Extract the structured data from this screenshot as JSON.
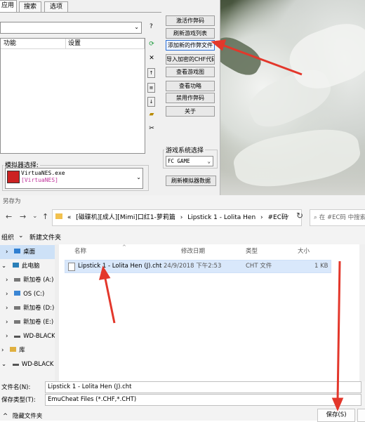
{
  "tool": {
    "tabs": [
      "应用",
      "搜索",
      "选项"
    ],
    "question_mark": "?",
    "columns": [
      "功能",
      "设置"
    ],
    "buttons": [
      "激活作弊码",
      "刷新游戏列表",
      "添加新的作弊文件",
      "导入加密的CHF代码",
      "查看游戏图",
      "查看功略",
      "禁用作弊码",
      "关于"
    ],
    "emulator_group_label": "模拟器选择:",
    "emulator_name": "VirtuaNES.exe",
    "emulator_tag": "[VirtuaNES]",
    "game_system_label": "游戏系统选择",
    "game_system_value": "FC GAME",
    "refresh_emu_button": "刷新模拟器数据"
  },
  "dialog": {
    "title": "另存为",
    "breadcrumb": [
      "«",
      "[磁碟机][成人][Mimi]口红1-萝莉篇",
      "Lipstick 1 - Lolita Hen",
      "#EC码"
    ],
    "search_placeholder": "在 #EC码 中搜索",
    "cmd_organize": "组织",
    "cmd_new_folder": "新建文件夹",
    "nav_items": [
      {
        "label": "桌面",
        "icon": "desktop-icon"
      },
      {
        "label": "此电脑",
        "icon": "computer-icon"
      },
      {
        "label": "新加卷 (A:)",
        "icon": "drive-icon"
      },
      {
        "label": "OS (C:)",
        "icon": "windows-drive-icon"
      },
      {
        "label": "新加卷 (D:)",
        "icon": "drive-icon"
      },
      {
        "label": "新加卷 (E:)",
        "icon": "drive-icon"
      },
      {
        "label": "WD-BLACK",
        "icon": "drive-icon"
      },
      {
        "label": "库",
        "icon": "library-icon"
      },
      {
        "label": "WD-BLACK (F",
        "icon": "drive-icon"
      }
    ],
    "headers": {
      "name": "名称",
      "modified": "修改日期",
      "type": "类型",
      "size": "大小"
    },
    "files": [
      {
        "name": "Lipstick 1 - Lolita Hen (J).cht",
        "modified": "24/9/2018 下午2:53",
        "type": "CHT 文件",
        "size": "1 KB"
      }
    ],
    "filename_label": "文件名(N):",
    "filename_value": "Lipstick 1 - Lolita Hen (J).cht",
    "filetype_label": "保存类型(T):",
    "filetype_value": "EmuCheat Files (*.CHF,*.CHT)",
    "hide_folders": "隐藏文件夹",
    "save_button": "保存(S)"
  },
  "colors": {
    "accent": "#e3372b",
    "selection": "#cde1f7"
  }
}
